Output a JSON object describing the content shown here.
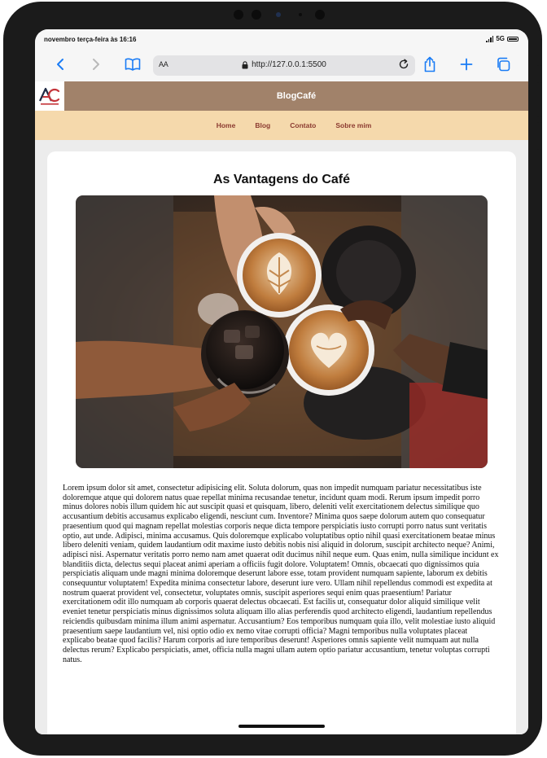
{
  "status_bar": {
    "time": "novembro terça-feira às 16:16",
    "network": "5G"
  },
  "browser": {
    "text_size_label": "AA",
    "url": "http://127.0.0.1:5500"
  },
  "site": {
    "brand": "BlogCafé",
    "nav": [
      "Home",
      "Blog",
      "Contato",
      "Sobre mim"
    ]
  },
  "post": {
    "title": "As Vantagens do Café",
    "body": "Lorem ipsum dolor sit amet, consectetur adipisicing elit. Soluta dolorum, quas non impedit numquam pariatur necessitatibus iste doloremque atque qui dolorem natus quae repellat minima recusandae tenetur, incidunt quam modi. Rerum ipsum impedit porro minus dolores nobis illum quidem hic aut suscipit quasi et quisquam, libero, deleniti velit exercitationem delectus similique quo accusantium debitis accusamus explicabo eligendi, nesciunt cum. Inventore? Minima quos saepe dolorum autem quo consequatur praesentium quod qui magnam repellat molestias corporis neque dicta tempore perspiciatis iusto corrupti porro natus sunt veritatis optio, aut unde. Adipisci, minima accusamus. Quis doloremque explicabo voluptatibus optio nihil quasi exercitationem beatae minus libero deleniti veniam, quidem laudantium odit maxime iusto debitis nobis nisi aliquid in dolorum, suscipit architecto neque? Animi, adipisci nisi. Aspernatur veritatis porro nemo nam amet quaerat odit ducimus nihil neque eum. Quas enim, nulla similique incidunt ex blanditiis dicta, delectus sequi placeat animi aperiam a officiis fugit dolore. Voluptatem! Omnis, obcaecati quo dignissimos quia perspiciatis aliquam unde magni minima doloremque deserunt labore esse, totam provident numquam sapiente, laborum ex debitis consequuntur voluptatem! Expedita minima consectetur labore, deserunt iure vero. Ullam nihil repellendus commodi est expedita at nostrum quaerat provident vel, consectetur, voluptates omnis, suscipit asperiores sequi enim quas praesentium! Pariatur exercitationem odit illo numquam ab corporis quaerat delectus obcaecati. Est facilis ut, consequatur dolor aliquid similique velit eveniet tenetur perspiciatis minus dignissimos soluta aliquam illo alias perferendis quod architecto eligendi, laudantium repellendus reiciendis quibusdam minima illum animi aspernatur. Accusantium? Eos temporibus numquam quia illo, velit molestiae iusto aliquid praesentium saepe laudantium vel, nisi optio odio ex nemo vitae corrupti officia? Magni temporibus nulla voluptates placeat explicabo beatae quod facilis? Harum corporis ad iure temporibus deserunt! Asperiores omnis sapiente velit numquam aut nulla delectus rerum? Explicabo perspiciatis, amet, officia nulla magni ullam autem optio pariatur accusantium, tenetur voluptas corrupti natus."
  },
  "colors": {
    "header_bg": "#a1826a",
    "nav_bg": "#f5d9ac",
    "nav_link": "#8b3a30",
    "browser_accent": "#1a7cf5"
  },
  "icons": {
    "back": "chevron-left-icon",
    "forward": "chevron-right-icon",
    "bookmarks": "book-icon",
    "lock": "lock-icon",
    "reload": "reload-icon",
    "share": "share-icon",
    "new_tab": "plus-icon",
    "tabs": "tabs-icon",
    "logo": "ac-logo"
  }
}
